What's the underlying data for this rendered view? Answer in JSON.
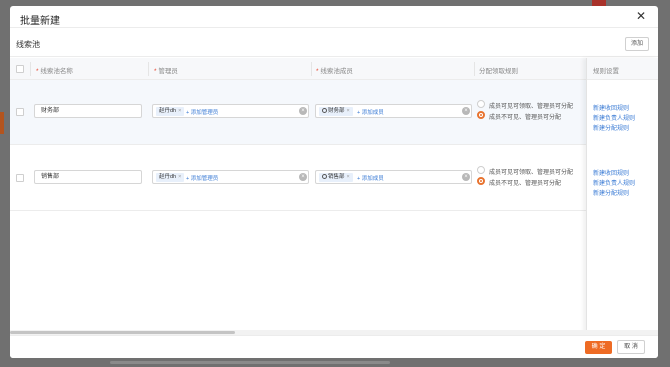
{
  "modal": {
    "title": "批量新建",
    "close_icon": "close-icon"
  },
  "section": {
    "title": "线索池",
    "add_button": "添加"
  },
  "table": {
    "columns": {
      "name": "线索池名称",
      "admins": "管理员",
      "members": "线索池成员",
      "rule": "分配领取规则",
      "settings": "规则设置"
    },
    "rows": [
      {
        "name": "财务部",
        "admin_tag": "赵丹dh",
        "add_admin": "+ 添加管理员",
        "member_tag": "财务部",
        "add_member": "+ 添加成员",
        "rule_option_1": "成员可见可领取、管理员可分配",
        "rule_option_2": "成员不可见、管理员可分配",
        "link_1": "新建收回规则",
        "link_2": "新建负责人规则",
        "link_3": "新建分配规则"
      },
      {
        "name": "销售部",
        "admin_tag": "赵丹dh",
        "add_admin": "+ 添加管理员",
        "member_tag": "销售部",
        "add_member": "+ 添加成员",
        "rule_option_1": "成员可见可领取、管理员可分配",
        "rule_option_2": "成员不可见、管理员可分配",
        "link_1": "新建收回规则",
        "link_2": "新建负责人规则",
        "link_3": "新建分配规则"
      }
    ]
  },
  "footer": {
    "confirm": "确 定",
    "cancel": "取 消"
  },
  "colors": {
    "accent": "#ee6b24",
    "link": "#3a7bd5",
    "required": "#e7452f"
  }
}
